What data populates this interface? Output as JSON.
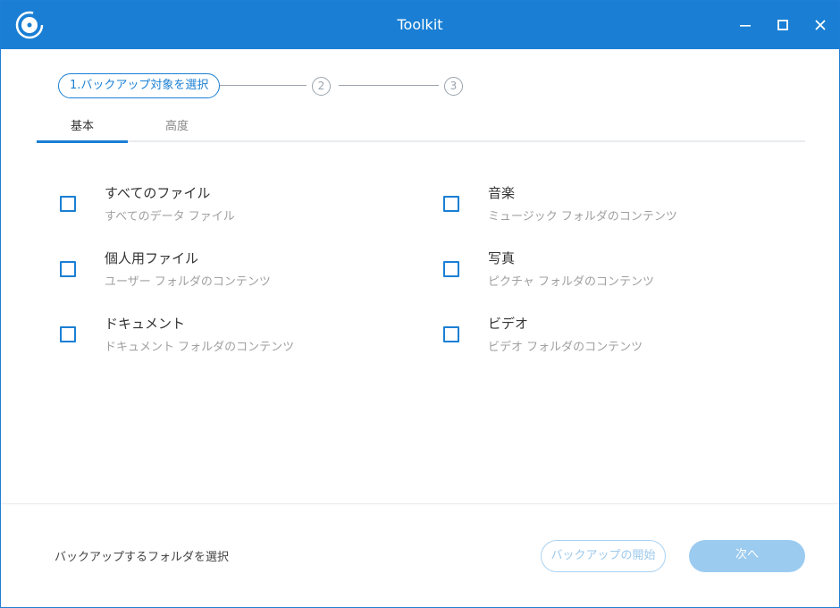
{
  "window": {
    "title": "Toolkit",
    "accent_color": "#1a7fd4",
    "icons": {
      "logo": "disc-logo-icon",
      "minimize": "minimize-icon",
      "maximize": "maximize-icon",
      "close": "close-icon"
    }
  },
  "steps": {
    "active_label": "1.バックアップ対象を選択",
    "step2": "2",
    "step3": "3"
  },
  "tabs": [
    {
      "label": "基本",
      "active": true
    },
    {
      "label": "高度",
      "active": false
    }
  ],
  "options": [
    {
      "title": "すべてのファイル",
      "subtitle": "すべてのデータ ファイル",
      "checked": false
    },
    {
      "title": "個人用ファイル",
      "subtitle": "ユーザー フォルダのコンテンツ",
      "checked": false
    },
    {
      "title": "ドキュメント",
      "subtitle": "ドキュメント フォルダのコンテンツ",
      "checked": false
    },
    {
      "title": "音楽",
      "subtitle": "ミュージック フォルダのコンテンツ",
      "checked": false
    },
    {
      "title": "写真",
      "subtitle": "ピクチャ フォルダのコンテンツ",
      "checked": false
    },
    {
      "title": "ビデオ",
      "subtitle": "ビデオ フォルダのコンテンツ",
      "checked": false
    }
  ],
  "footer": {
    "folder_link": "バックアップするフォルダを選択",
    "start_button": "バックアップの開始",
    "next_button": "次へ"
  }
}
